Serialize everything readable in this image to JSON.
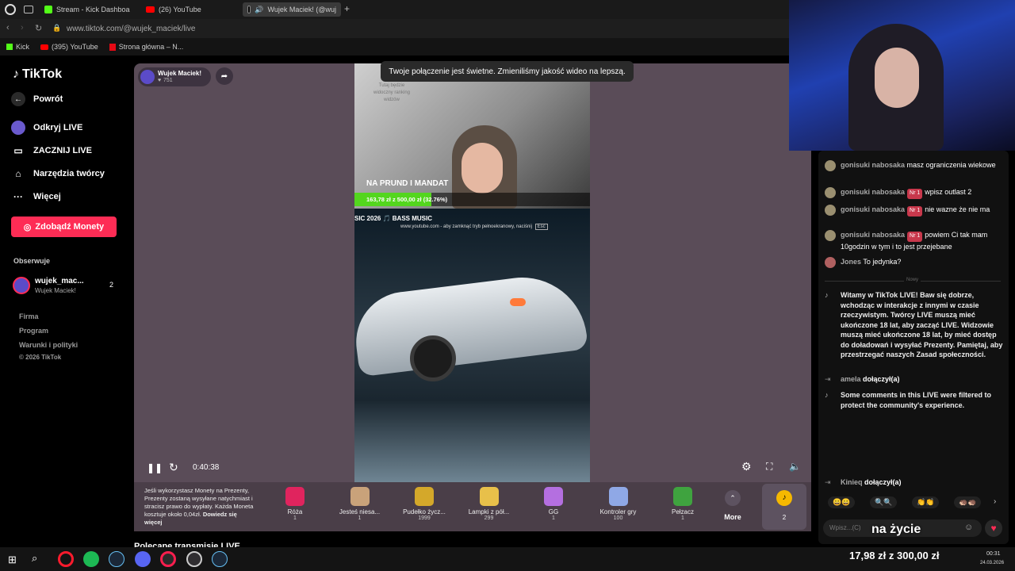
{
  "browser": {
    "tabs": [
      {
        "label": "Stream - Kick Dashboa"
      },
      {
        "label": "(26) YouTube"
      },
      {
        "label": "Wujek Maciek! (@wuj"
      }
    ],
    "new_tab": "+",
    "url": "www.tiktok.com/@wujek_maciek/live",
    "bookmarks": [
      {
        "label": "Kick"
      },
      {
        "label": "(395) YouTube"
      },
      {
        "label": "Strona główna – N..."
      }
    ]
  },
  "sidebar": {
    "logo": "TikTok",
    "back": "Powrót",
    "nav": [
      {
        "label": "Odkryj LIVE"
      },
      {
        "label": "ZACZNIJ LIVE"
      },
      {
        "label": "Narzędzia twórcy"
      },
      {
        "label": "Więcej"
      }
    ],
    "coins_button": "Zdobądź Monety",
    "following_title": "Obserwuje",
    "following": {
      "name": "wujek_mac...",
      "subname": "Wujek Maciek!",
      "count": "2"
    },
    "footer": [
      "Firma",
      "Program",
      "Warunki i polityki",
      "© 2026 TikTok"
    ]
  },
  "player": {
    "host_name": "Wujek Maciek!",
    "host_likes": "751",
    "toast": "Twoje połączenie jest świetne. Zmieniliśmy jakość wideo na lepszą.",
    "overlay_note": "Tutaj będzie widoczny ranking widzów",
    "goal_title": "NA PRUND I MANDAT",
    "goal_text": "163,78 zł z 500,00 zł (32.76%)",
    "goal_progress": 0.3276,
    "music_text": "SIC 2026 🎵 BASS MUSIC",
    "yt_notice": "www.youtube.com - aby zamknąć tryb pełnoekranowy, naciśnij",
    "yt_key": "Esc",
    "time": "0:40:38"
  },
  "gifts": {
    "info": "Jeśli wykorzystasz Monety na Prezenty, Prezenty zostaną wysyłane natychmiast i stracisz prawo do wypłaty. Każda Moneta kosztuje około 0,04zł.",
    "info_link": "Dowiedz się więcej",
    "items": [
      {
        "name": "Róża",
        "price": "1",
        "color": "#e0245e"
      },
      {
        "name": "Jesteś niesa...",
        "price": "1",
        "color": "#c9a27a"
      },
      {
        "name": "Pudełko życz...",
        "price": "1999",
        "color": "#d4a82a"
      },
      {
        "name": "Lampki z pół...",
        "price": "299",
        "color": "#e8c04a"
      },
      {
        "name": "GG",
        "price": "1",
        "color": "#b46fe0"
      },
      {
        "name": "Kontroler gry",
        "price": "100",
        "color": "#8fa8e6"
      },
      {
        "name": "Pełzacz",
        "price": "1",
        "color": "#3fa33f"
      }
    ],
    "more": "More",
    "coins_count": "2"
  },
  "chat": {
    "messages": [
      {
        "user": "gonisuki nabosaka",
        "badge": "",
        "text": "masz ograniczenia wiekowe"
      },
      {
        "user": "gonisuki nabosaka",
        "badge": "Nr 1",
        "text": "wpisz outlast 2"
      },
      {
        "user": "gonisuki nabosaka",
        "badge": "Nr 1",
        "text": "nie wazne że nie ma"
      },
      {
        "user": "gonisuki nabosaka",
        "badge": "Nr 1",
        "text": "powiem Ci tak mam 10godzin w tym i to jest przejebane"
      },
      {
        "user": "Jones",
        "badge": "",
        "text": "To jedynka?"
      }
    ],
    "divider": "Nowy",
    "system_welcome": "Witamy w TikTok LIVE! Baw się dobrze, wchodząc w interakcje z innymi w czasie rzeczywistym. Twórcy LIVE muszą mieć ukończone 18 lat, aby zacząć LIVE. Widzowie muszą mieć ukończone 18 lat, by mieć dostęp do doładowań i wysyłać Prezenty. Pamiętaj, aby przestrzegać naszych Zasad społeczności.",
    "joined1_user": "amela",
    "joined_text": "dołączył(a)",
    "system_filter": "Some comments in this LIVE were filtered to protect the community's experience.",
    "joined2_user": "Kinieq",
    "quick_reactions": [
      "😀😀",
      "🔍🔍",
      "👏👏",
      "🦔🦔"
    ],
    "input_placeholder": "Wpisz...(C)"
  },
  "stream_overlay": {
    "caption": "na życie",
    "goal": "17,98 zł z 300,00 zł"
  },
  "taskbar": {
    "time": "00:31",
    "date": "24.03.2026"
  }
}
